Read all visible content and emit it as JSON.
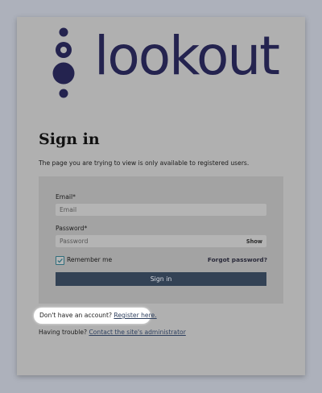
{
  "brand": {
    "name": "lookout",
    "color": "#24234f"
  },
  "page": {
    "title": "Sign in",
    "subtitle": "The page you are trying to view is only available to registered users."
  },
  "form": {
    "email_label": "Email*",
    "email_placeholder": "Email",
    "password_label": "Password*",
    "password_placeholder": "Password",
    "show_label": "Show",
    "remember_label": "Remember me",
    "remember_checked": true,
    "forgot_label": "Forgot password?",
    "submit_label": "Sign in"
  },
  "footer": {
    "register_prompt": "Don't have an account? ",
    "register_link": "Register here.",
    "trouble_prompt": "Having trouble? ",
    "trouble_link": "Contact the site's administrator"
  },
  "colors": {
    "button": "#334255",
    "checkbox": "#2f6e7c",
    "link": "#2d3f5e"
  }
}
